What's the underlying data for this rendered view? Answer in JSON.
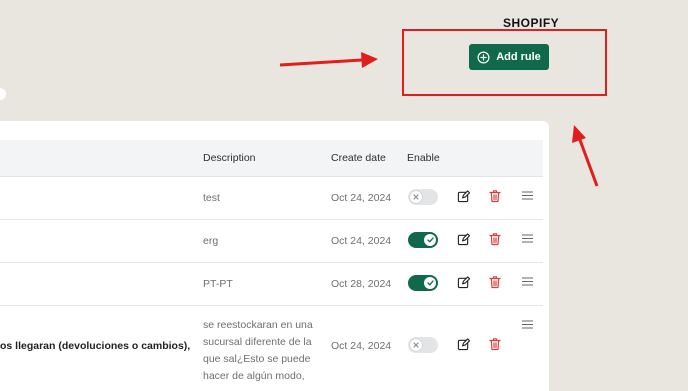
{
  "header": {
    "store_name": "SHOPIFY",
    "add_rule_label": "Add rule"
  },
  "table": {
    "columns": [
      "Description",
      "Create date",
      "Enable"
    ],
    "rows": [
      {
        "title": "",
        "description": "test",
        "date": "Oct 24, 2024",
        "enabled": false
      },
      {
        "title": "",
        "description": "erg",
        "date": "Oct 24, 2024",
        "enabled": true
      },
      {
        "title": "",
        "description": "PT-PT",
        "date": "Oct 28, 2024",
        "enabled": true
      },
      {
        "title": "os llegaran (devoluciones o cambios),",
        "description": "se reestockaran en una sucursal diferente de la que sal¿Esto se puede hacer de algún modo,",
        "date": "Oct 24, 2024",
        "enabled": false
      }
    ]
  },
  "colors": {
    "primary": "#10694b",
    "delete": "#e03b3b",
    "highlight": "#e01e1e"
  },
  "icons": {
    "add": "plus-circle-icon",
    "edit": "pencil-icon",
    "delete": "trash-icon",
    "drag": "drag-handle-icon"
  }
}
